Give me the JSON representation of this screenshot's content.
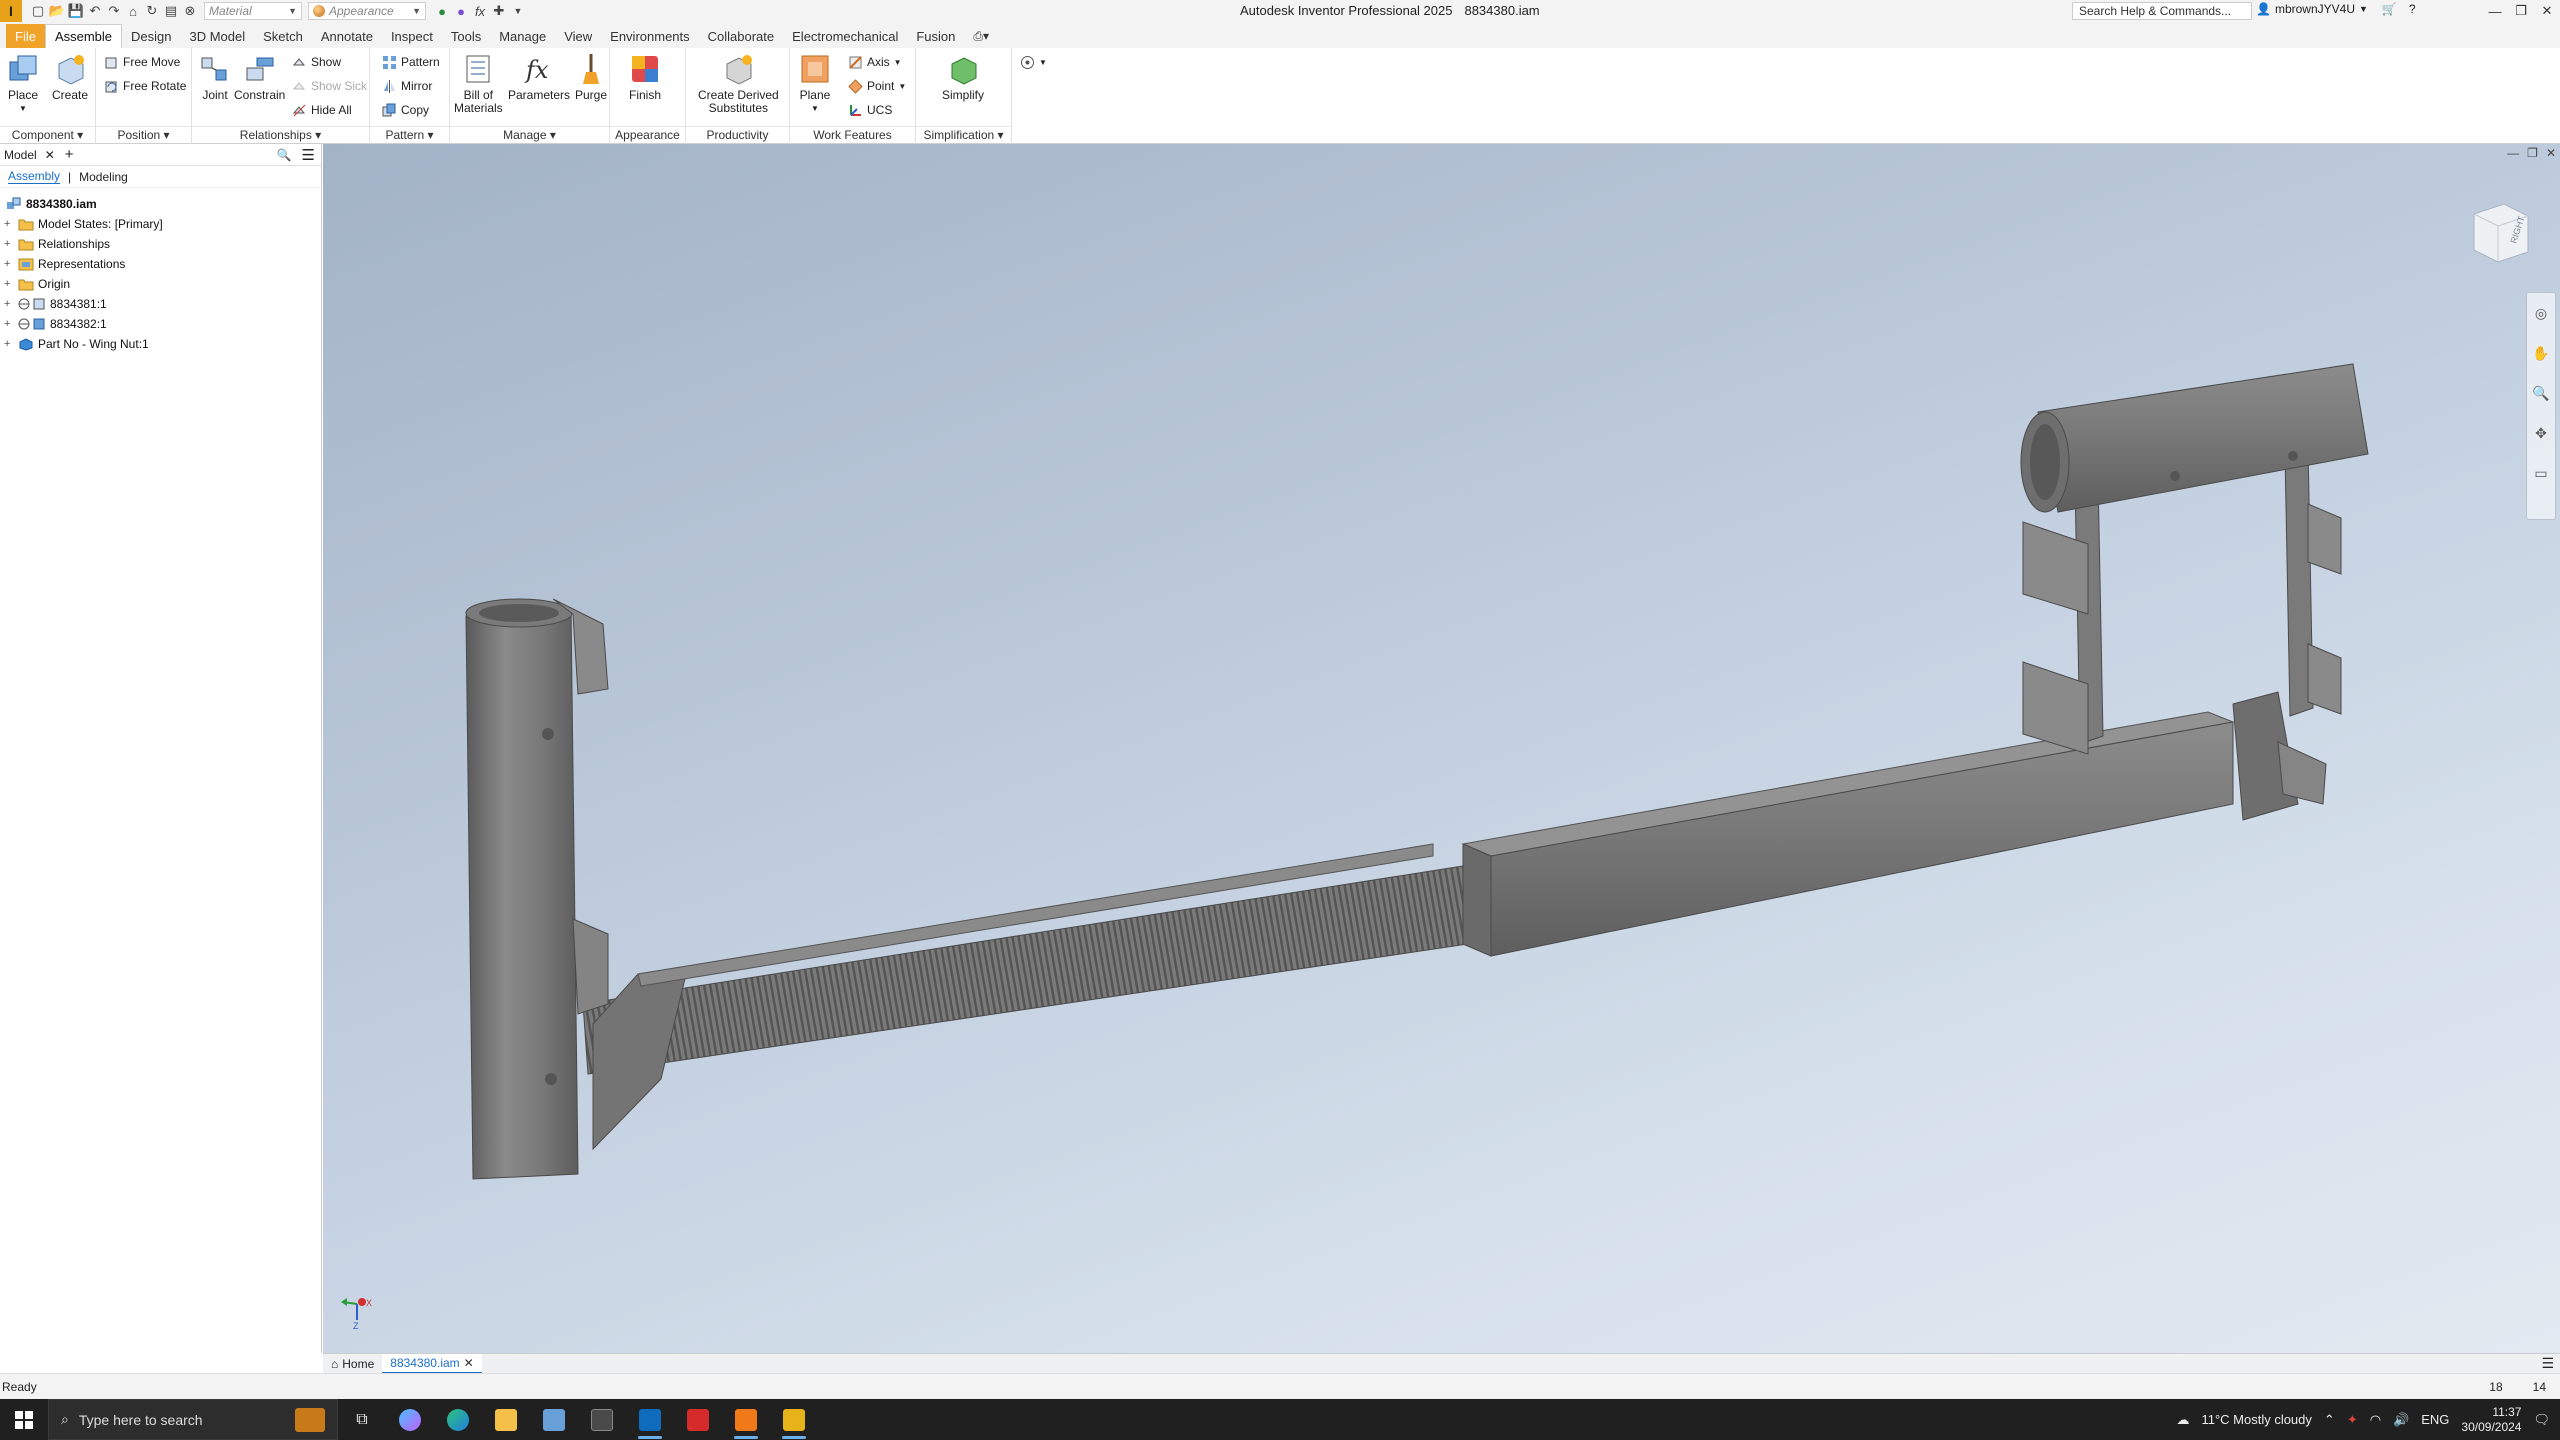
{
  "app": {
    "logo": "I",
    "title": "Autodesk Inventor Professional 2025",
    "document": "8834380.iam"
  },
  "quick_access": {
    "material_placeholder": "Material",
    "appearance_placeholder": "Appearance"
  },
  "help": {
    "search_placeholder": "Search Help & Commands...",
    "user": "mbrownJYV4U"
  },
  "menu_tabs": [
    "File",
    "Assemble",
    "Design",
    "3D Model",
    "Sketch",
    "Annotate",
    "Inspect",
    "Tools",
    "Manage",
    "View",
    "Environments",
    "Collaborate",
    "Electromechanical",
    "Fusion"
  ],
  "ribbon": {
    "component": {
      "title": "Component",
      "place": "Place",
      "create": "Create"
    },
    "position": {
      "title": "Position",
      "free_move": "Free Move",
      "free_rotate": "Free Rotate"
    },
    "relationships": {
      "title": "Relationships",
      "joint": "Joint",
      "constrain": "Constrain",
      "show": "Show",
      "show_sick": "Show Sick",
      "hide_all": "Hide All"
    },
    "pattern": {
      "title": "Pattern",
      "pattern": "Pattern",
      "mirror": "Mirror",
      "copy": "Copy"
    },
    "manage": {
      "title": "Manage",
      "bom_line1": "Bill of",
      "bom_line2": "Materials",
      "parameters": "Parameters",
      "purge": "Purge"
    },
    "appearance": {
      "title": "Appearance",
      "finish": "Finish"
    },
    "productivity": {
      "title": "Productivity",
      "line1": "Create Derived",
      "line2": "Substitutes"
    },
    "work_features": {
      "title": "Work Features",
      "plane": "Plane",
      "axis": "Axis",
      "point": "Point",
      "ucs": "UCS"
    },
    "simplification": {
      "title": "Simplification",
      "simplify": "Simplify"
    }
  },
  "browser": {
    "tab": "Model",
    "subtabs": [
      "Assembly",
      "Modeling"
    ],
    "root": "8834380.iam",
    "nodes": [
      "Model States: [Primary]",
      "Relationships",
      "Representations",
      "Origin",
      "8834381:1",
      "8834382:1",
      "Part No - Wing Nut:1"
    ]
  },
  "viewcube": {
    "face": "RIGHT"
  },
  "triad": {
    "x": "X",
    "z": "Z"
  },
  "doc_tabs": {
    "home": "Home",
    "active": "8834380.iam"
  },
  "status": {
    "text": "Ready",
    "num1": "18",
    "num2": "14"
  },
  "taskbar": {
    "search_placeholder": "Type here to search",
    "weather": "11°C  Mostly cloudy",
    "lang": "ENG",
    "time": "11:37",
    "date": "30/09/2024"
  },
  "colors": {
    "accent": "#f0a328",
    "selection": "#1a6fc9",
    "viewport_top": "#a3b3c6",
    "viewport_bottom": "#e3e9f1"
  }
}
